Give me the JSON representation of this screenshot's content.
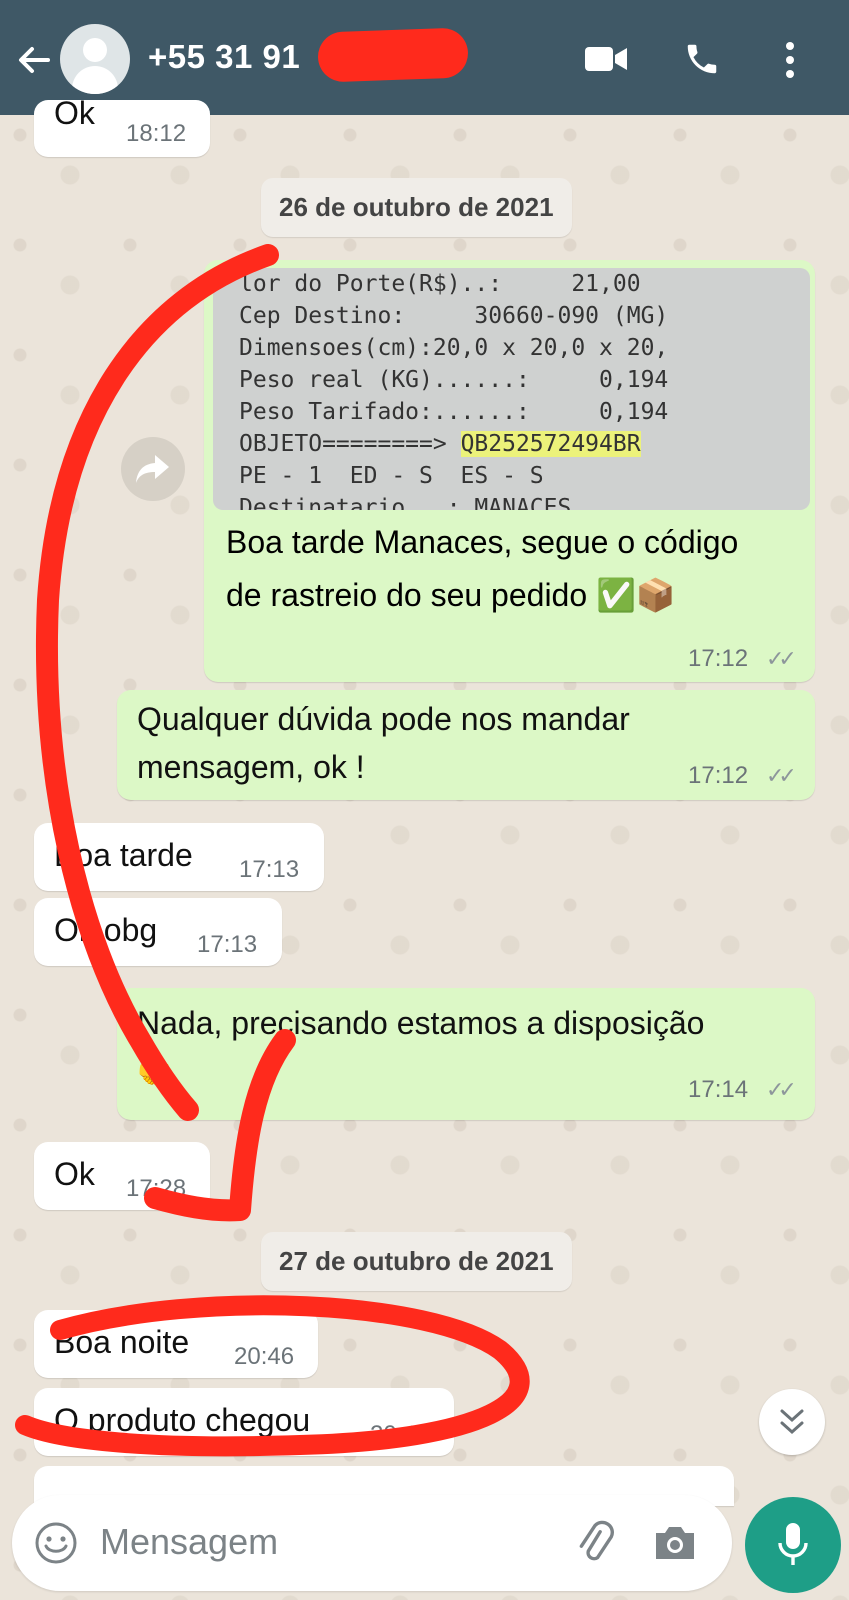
{
  "header": {
    "contact": "+55 31 91",
    "icons": [
      "back-arrow-icon",
      "avatar",
      "video-call-icon",
      "phone-icon",
      "more-vert-icon"
    ]
  },
  "messages": {
    "m0": {
      "text": "Ok",
      "time": "18:12"
    },
    "date1": "26 de outubro de 2021",
    "image": {
      "receipt_lines": [
        "lor do Porte(R$)..:     21,00",
        "Cep Destino:     30660-090 (MG)",
        "Dimensoes(cm):20,0 x 20,0 x 20,",
        "Peso real (KG)......:     0,194",
        "Peso Tarifado:......:     0,194",
        "PE - 1  ED - S  ES - S",
        "Destinatario...: MANACES"
      ],
      "objeto_label": "OBJETO========> ",
      "objeto_code": "QB252572494BR"
    },
    "m1": {
      "line1": "Boa tarde Manaces, segue o código",
      "line2": "de rastreio do seu pedido ✅📦",
      "time": "17:12",
      "status": "✓✓"
    },
    "m2": {
      "line1": "Qualquer dúvida pode nos mandar",
      "line2": "mensagem, ok !",
      "time": "17:12",
      "status": "✓✓"
    },
    "m3": {
      "text": "Boa tarde",
      "time": "17:13"
    },
    "m4": {
      "text": "Ok obg",
      "time": "17:13"
    },
    "m5": {
      "line1": "Nada, precisando estamos a disposição",
      "line2": "🤝",
      "time": "17:14",
      "status": "✓✓"
    },
    "m6": {
      "text": "Ok",
      "time": "17:28"
    },
    "date2": "27 de outubro de 2021",
    "m7": {
      "text": "Boa noite",
      "time": "20:46"
    },
    "m8": {
      "text": "O produto chegou",
      "time": "20:47"
    }
  },
  "composer": {
    "placeholder": "Mensagem"
  },
  "colors": {
    "header": "#3f5866",
    "outgoing": "#dcf8c6",
    "incoming": "#ffffff",
    "annotation": "#ff2a1c",
    "mic": "#1e9e87"
  }
}
